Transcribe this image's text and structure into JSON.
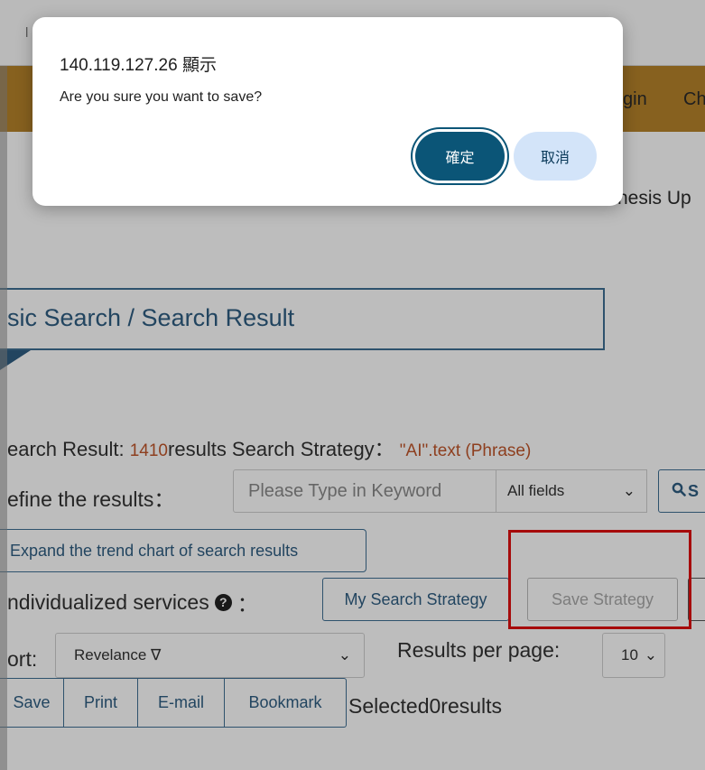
{
  "browser": {
    "url_fragment": "l"
  },
  "header": {
    "nav_login": "gin",
    "nav_other": "Ch"
  },
  "news_fragment": "hesis Up",
  "page_title": "sic Search / Search Result",
  "search_result": {
    "prefix": "earch Result: ",
    "count": "1410",
    "middle": "results Search Strategy： ",
    "strategy": "\"AI\".text (Phrase)"
  },
  "refine": {
    "label": "efine the results：",
    "placeholder": "Please Type in Keyword",
    "field_selected": "All fields",
    "search_button": "S"
  },
  "trend_button": "Expand the trend chart of search results",
  "services": {
    "label": "ndividualized services",
    "colon": "：",
    "my_strategy": "My Search Strategy",
    "save_strategy": "Save Strategy"
  },
  "sort": {
    "label": "ort:",
    "selected": "Revelance ∇",
    "per_page_label": "Results per page:",
    "per_page_value": "10"
  },
  "actions": [
    "Save",
    "Print",
    "E-mail",
    "Bookmark"
  ],
  "selected_text": "Selected0results",
  "dialog": {
    "origin": "140.119.127.26 顯示",
    "message": "Are you sure you want to save?",
    "ok_label": "確定",
    "cancel_label": "取消"
  },
  "colors": {
    "header_bg": "#b7832b",
    "accent": "#2f5d82",
    "highlight_border": "#e01010",
    "dialog_ok_bg": "#0b5577"
  }
}
